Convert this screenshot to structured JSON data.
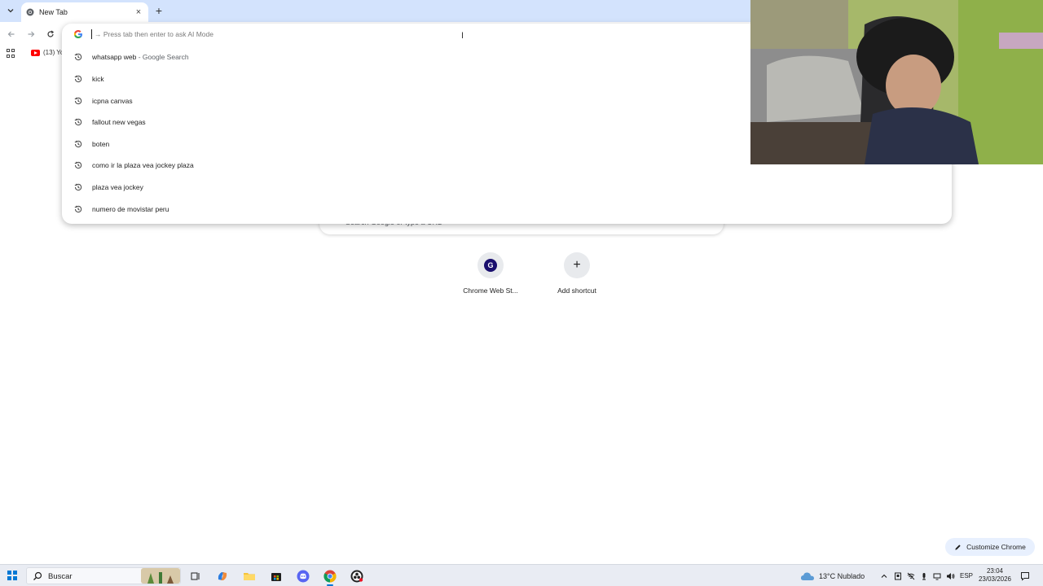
{
  "browser": {
    "tab": {
      "title": "New Tab",
      "close_glyph": "×"
    },
    "new_tab_glyph": "+"
  },
  "bookmarks": {
    "youtube_label": "(13) Yo"
  },
  "omnibox": {
    "placeholder": "→ Press tab then enter to ask AI Mode",
    "suggestions": [
      {
        "text": "whatsapp web",
        "sub": " - Google Search",
        "icon": "history-icon"
      },
      {
        "text": "kick",
        "sub": "",
        "icon": "history-icon"
      },
      {
        "text": "icpna canvas",
        "sub": "",
        "icon": "history-icon"
      },
      {
        "text": "fallout new vegas",
        "sub": "",
        "icon": "history-icon"
      },
      {
        "text": "boten",
        "sub": "",
        "icon": "history-icon"
      },
      {
        "text": "como ir la plaza vea jockey plaza",
        "sub": "",
        "icon": "history-icon"
      },
      {
        "text": "plaza vea jockey",
        "sub": "",
        "icon": "history-icon"
      },
      {
        "text": "numero de movistar peru",
        "sub": "",
        "icon": "history-icon"
      }
    ]
  },
  "newtab": {
    "search_placeholder": "Search Google or type a URL",
    "shortcuts": [
      {
        "label": "Chrome Web St...",
        "icon": "chrome-web-store-icon",
        "letter": "G"
      },
      {
        "label": "Add shortcut",
        "icon": "plus-icon",
        "letter": "+"
      }
    ],
    "customize_label": "Customize Chrome"
  },
  "taskbar": {
    "search_label": "Buscar",
    "weather": "13°C  Nublado",
    "language": "ESP",
    "time": "23:04",
    "date": "23/03/2026"
  },
  "colors": {
    "tabstrip": "#d3e3fd",
    "accent": "#0078d4",
    "customize_bg": "#e8f0fe"
  }
}
